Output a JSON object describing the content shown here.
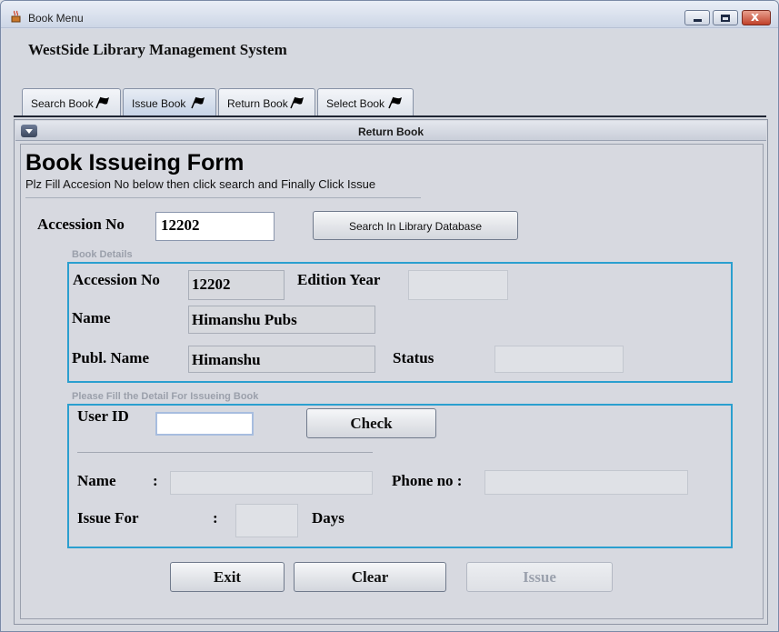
{
  "window": {
    "title": "Book Menu",
    "minimize_icon": "minimize-icon",
    "maximize_icon": "maximize-icon",
    "close_icon": "close-icon",
    "close_glyph": "x"
  },
  "app": {
    "title": "WestSide Library Management System"
  },
  "tabs": [
    {
      "label": "Search Book",
      "icon": "flag-icon"
    },
    {
      "label": "Issue Book",
      "icon": "flag-icon",
      "active": true
    },
    {
      "label": "Return Book",
      "icon": "flag-icon"
    },
    {
      "label": "Select Book",
      "icon": "flag-icon"
    }
  ],
  "internal_frame": {
    "title": "Return Book"
  },
  "form": {
    "title": "Book Issueing Form",
    "subtitle": "Plz Fill Accesion No below then click search and Finally Click Issue",
    "accession_label": "Accession No",
    "accession_value": "12202",
    "search_button": "Search In Library Database"
  },
  "book_details": {
    "group_title": "Book Details",
    "accession_label": "Accession No",
    "accession_value": "12202",
    "edition_label": "Edition Year",
    "edition_value": "",
    "name_label": "Name",
    "name_value": "Himanshu Pubs",
    "publ_label": "Publ. Name",
    "publ_value": "Himanshu",
    "status_label": "Status",
    "status_value": ""
  },
  "issue_details": {
    "group_title": "Please Fill the Detail For Issueing Book",
    "user_id_label": "User ID",
    "user_id_value": "",
    "check_button": "Check",
    "name_label": "Name",
    "name_colon": ":",
    "name_value": "",
    "phone_label": "Phone no :",
    "phone_value": "",
    "issue_for_label": "Issue For",
    "issue_colon": ":",
    "issue_days_value": "",
    "days_label": "Days"
  },
  "actions": {
    "exit": "Exit",
    "clear": "Clear",
    "issue": "Issue"
  },
  "colors": {
    "group_border": "#2a9fcf",
    "close_button": "#c0412a"
  }
}
